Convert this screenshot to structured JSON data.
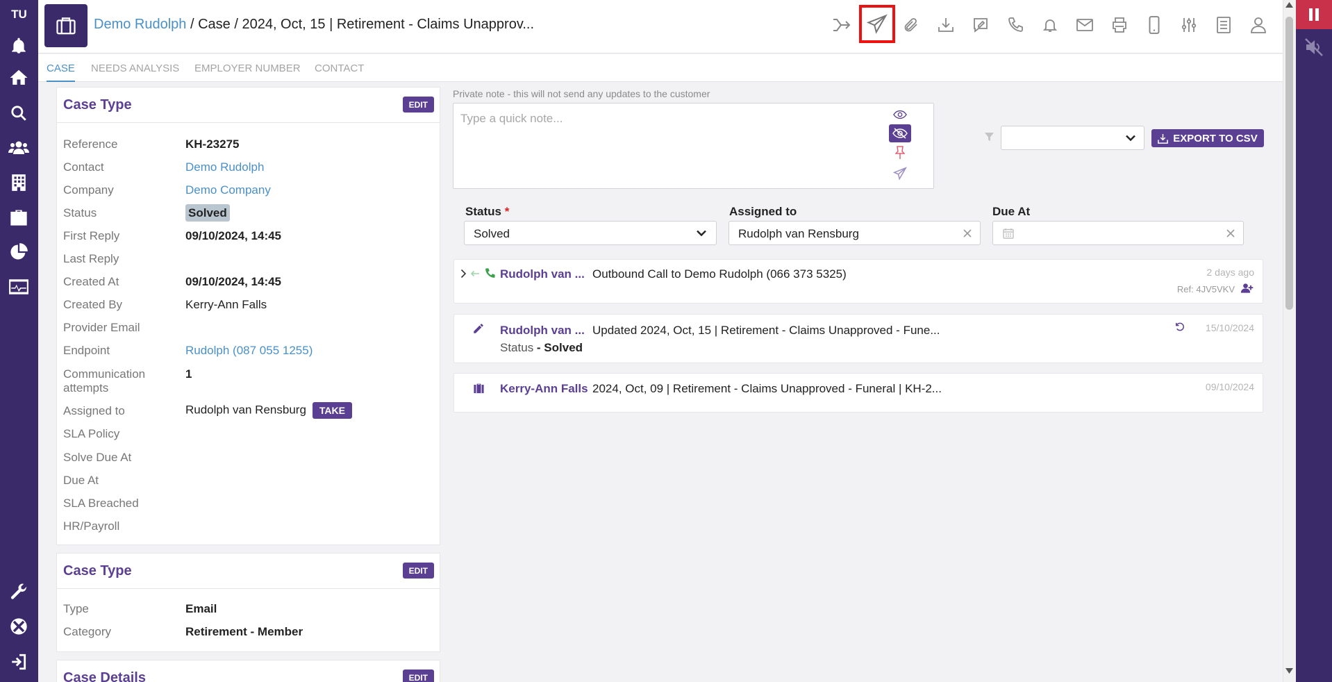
{
  "app": {
    "user_initials": "TU"
  },
  "header": {
    "contact_link": "Demo Rudolph",
    "crumb_rest": " / Case / 2024, Oct, 15 | Retirement - Claims Unapprov..."
  },
  "tabs": [
    "CASE",
    "NEEDS ANALYSIS",
    "EMPLOYER NUMBER",
    "CONTACT"
  ],
  "case_card": {
    "title": "Case Type",
    "edit": "EDIT",
    "rows": [
      {
        "label": "Reference",
        "value": "KH-23275"
      },
      {
        "label": "Contact",
        "value": "Demo Rudolph"
      },
      {
        "label": "Company",
        "value": "Demo Company"
      },
      {
        "label": "Status",
        "value": "Solved"
      },
      {
        "label": "First Reply",
        "value": "09/10/2024, 14:45"
      },
      {
        "label": "Last Reply",
        "value": ""
      },
      {
        "label": "Created At",
        "value": "09/10/2024, 14:45"
      },
      {
        "label": "Created By",
        "value": "Kerry-Ann Falls"
      },
      {
        "label": "Provider Email",
        "value": ""
      },
      {
        "label": "Endpoint",
        "value": "Rudolph (087 055 1255)"
      },
      {
        "label": "Communication attempts",
        "value": "1"
      },
      {
        "label": "Assigned to",
        "value": "Rudolph van Rensburg",
        "action": "TAKE"
      },
      {
        "label": "SLA Policy",
        "value": ""
      },
      {
        "label": "Solve Due At",
        "value": ""
      },
      {
        "label": "Due At",
        "value": ""
      },
      {
        "label": "SLA Breached",
        "value": ""
      },
      {
        "label": "HR/Payroll",
        "value": ""
      }
    ]
  },
  "type_card": {
    "title": "Case Type",
    "edit": "EDIT",
    "rows": [
      {
        "label": "Type",
        "value": "Email"
      },
      {
        "label": "Category",
        "value": "Retirement - Member"
      }
    ]
  },
  "details_card": {
    "title": "Case Details",
    "edit": "EDIT"
  },
  "note": {
    "hint": "Private note - this will not send any updates to the customer",
    "placeholder": "Type a quick note..."
  },
  "filter": {
    "selected": ""
  },
  "export_label": "EXPORT TO CSV",
  "form": {
    "status_label": "Status",
    "status_required": "*",
    "status_value": "Solved",
    "assigned_label": "Assigned to",
    "assigned_value": "Rudolph van Rensburg",
    "due_label": "Due At",
    "due_value": ""
  },
  "activity": [
    {
      "author": "Rudolph van ...",
      "text": "Outbound Call to Demo Rudolph (066 373 5325)",
      "date": "2 days ago",
      "ref": "Ref: 4JV5VKV",
      "icon": "phone-icon"
    },
    {
      "author": "Rudolph van ...",
      "text": "Updated 2024, Oct, 15 | Retirement - Claims Unapproved - Fune...",
      "sub_label": "Status",
      "sub_value": " - Solved",
      "date": "15/10/2024",
      "icon": "pencil-icon"
    },
    {
      "author": "Kerry-Ann Falls",
      "text": "2024, Oct, 09 | Retirement - Claims Unapproved - Funeral | KH-2...",
      "date": "09/10/2024",
      "icon": "briefcase-icon"
    }
  ],
  "colors": {
    "brand": "#3b2a69",
    "accent": "#5b3f92",
    "link": "#4a90c8",
    "highlight": "#ee1111"
  }
}
